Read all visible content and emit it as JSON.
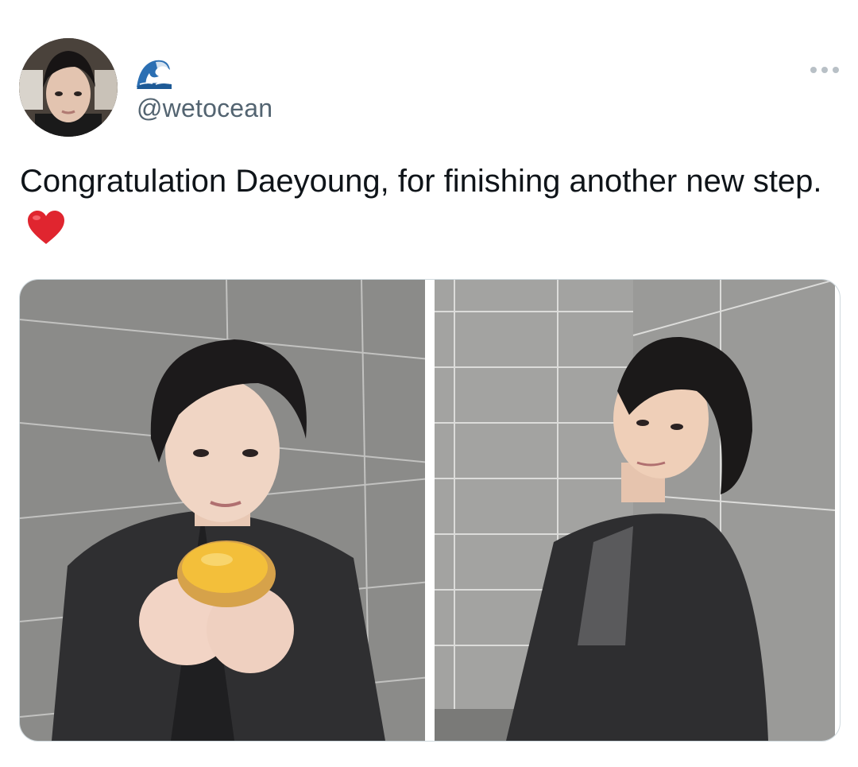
{
  "tweet": {
    "display_name_emoji": "water-wave-icon",
    "handle": "@wetocean",
    "text": "Congratulation Daeyoung, for finishing another new step.",
    "text_emoji": "red-heart-icon",
    "more_menu_icon": "more-horizontal-icon"
  },
  "media": {
    "count": 2,
    "photos": [
      {
        "subject": "photo-person-holding-egg-tart"
      },
      {
        "subject": "photo-person-leaning-on-wall"
      }
    ]
  },
  "colors": {
    "text_primary": "#0f1419",
    "text_secondary": "#536471",
    "heart": "#e0252f",
    "border": "#cfd9de"
  }
}
